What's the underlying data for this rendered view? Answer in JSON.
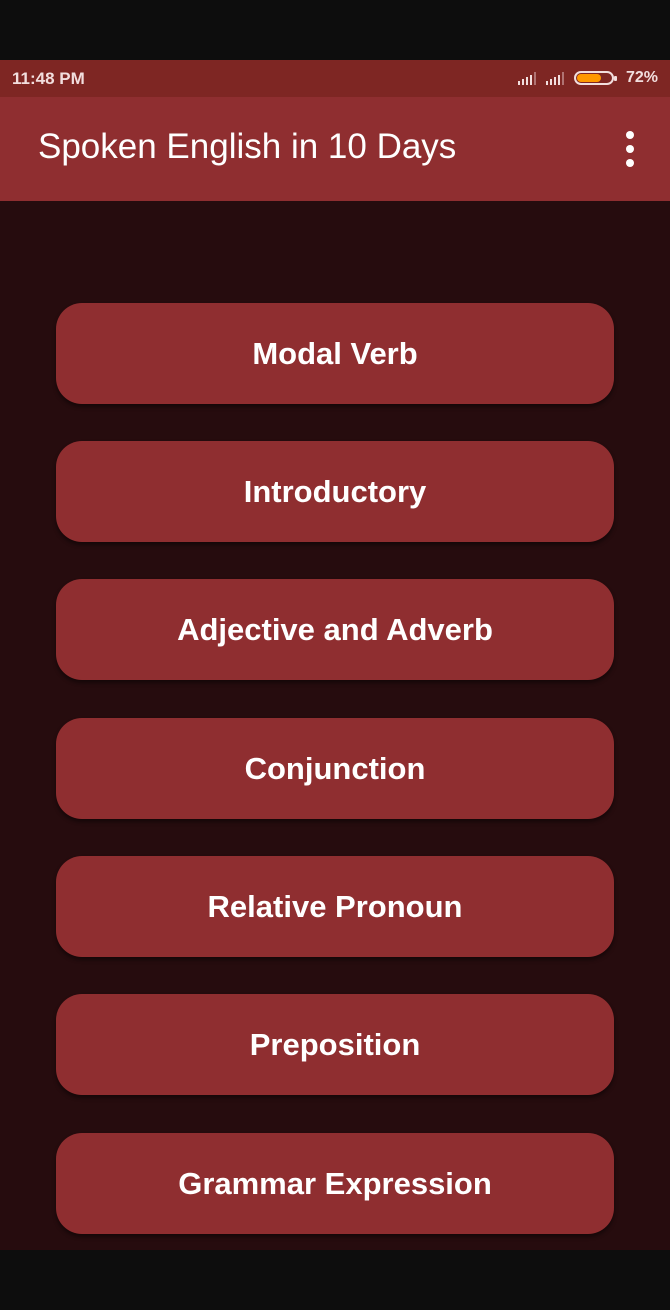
{
  "status_bar": {
    "time": "11:48 PM",
    "battery_percent": "72%",
    "battery_level": 0.72
  },
  "app_bar": {
    "title": "Spoken English in 10 Days",
    "menu_icon": "more-vert-icon"
  },
  "menu": {
    "items": [
      {
        "label": "Modal Verb"
      },
      {
        "label": "Introductory"
      },
      {
        "label": "Adjective and Adverb"
      },
      {
        "label": "Conjunction"
      },
      {
        "label": "Relative Pronoun"
      },
      {
        "label": "Preposition"
      },
      {
        "label": "Grammar Expression"
      }
    ]
  },
  "colors": {
    "status_bar": "#7e2623",
    "app_bar": "#8f2e30",
    "background": "#260c0e",
    "button": "#8f2e30",
    "battery": "#ff9800"
  }
}
